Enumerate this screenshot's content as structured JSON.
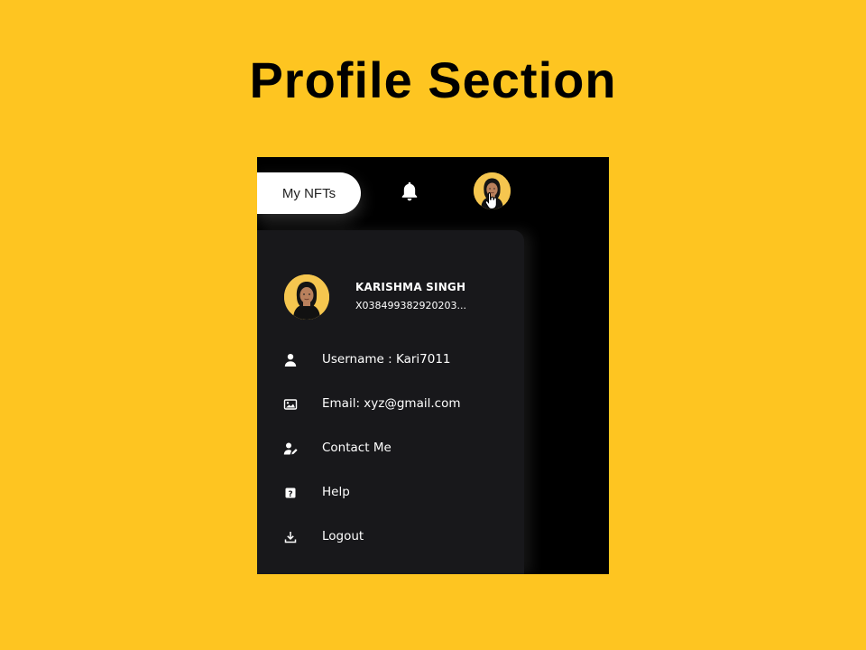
{
  "page": {
    "title": "Profile Section"
  },
  "header": {
    "nft_button_label": "My NFTs",
    "icons": {
      "notification": "bell-icon",
      "avatar": "avatar",
      "cursor": "hand-cursor-icon"
    }
  },
  "profile": {
    "name": "KARISHMA SINGH",
    "wallet_id": "X038499382920203..."
  },
  "menu": {
    "items": [
      {
        "icon": "user-icon",
        "label": "Username : Kari7011"
      },
      {
        "icon": "image-icon",
        "label": "Email: xyz@gmail.com"
      },
      {
        "icon": "contact-icon",
        "label": "Contact Me"
      },
      {
        "icon": "help-icon",
        "label": "Help"
      },
      {
        "icon": "download-icon",
        "label": "Logout"
      }
    ]
  },
  "colors": {
    "background": "#fec521",
    "app_background": "#000000",
    "panel_background": "#18181b",
    "text": "#ffffff",
    "avatar_background": "#f5c64f"
  }
}
